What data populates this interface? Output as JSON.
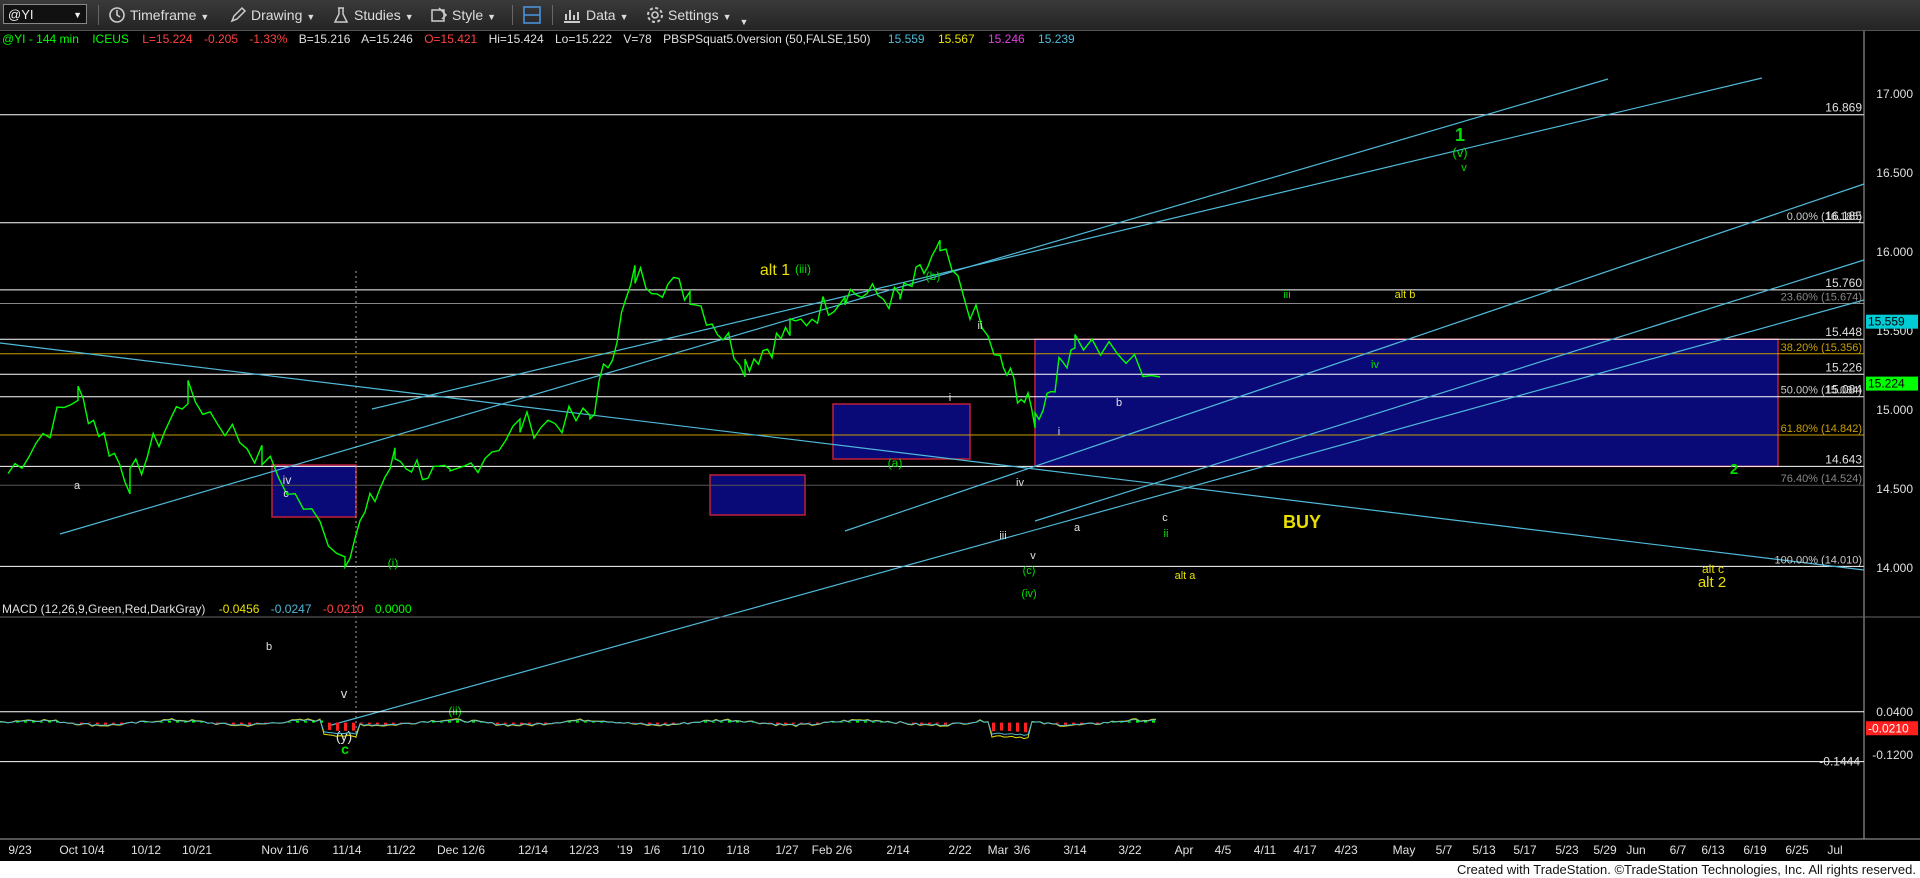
{
  "toolbar": {
    "symbol": "@YI",
    "timeframe": "Timeframe",
    "drawing": "Drawing",
    "studies": "Studies",
    "style": "Style",
    "data": "Data",
    "settings": "Settings"
  },
  "header": {
    "symbol_info": "@YI - 144 min",
    "exchange": "ICEUS",
    "last": "L=15.224",
    "change": "-0.205",
    "change_pct": "-1.33%",
    "bid": "B=15.216",
    "ask": "A=15.246",
    "open": "O=15.421",
    "high": "Hi=15.424",
    "low": "Lo=15.222",
    "volume": "V=78",
    "study": "PBSPSquat5.0version (50,FALSE,150)",
    "study_values": [
      "15.559",
      "15.567",
      "15.246",
      "15.239"
    ]
  },
  "macd": {
    "label": "MACD (12,26,9,Green,Red,DarkGray)",
    "values": [
      "-0.0456",
      "-0.0247",
      "-0.0210",
      "0.0000"
    ]
  },
  "footer": "Created with TradeStation. ©TradeStation Technologies, Inc. All rights reserved.",
  "colors": {
    "up": "#00ff00",
    "down": "#ff3030",
    "channel": "#4fb9d8",
    "zone": "#0a0a8c",
    "wave_green": "#00e000",
    "wave_yellow": "#e8e000",
    "wave_white": "#e0e0e0"
  },
  "chart_data": {
    "type": "line",
    "symbol": "@YI",
    "y_axis": {
      "ticks": [
        "17.000",
        "16.500",
        "16.000",
        "15.500",
        "15.000",
        "14.500",
        "14.000"
      ],
      "ylim": [
        13.85,
        17.4
      ]
    },
    "x_axis": {
      "ticks": [
        "9/23",
        "Oct 10/4",
        "10/12",
        "10/21",
        "Nov 11/6",
        "11/14",
        "11/22",
        "Dec 12/6",
        "12/14",
        "12/23",
        "'19",
        "1/6",
        "1/10",
        "1/18",
        "1/27",
        "Feb 2/6",
        "2/14",
        "2/22",
        "Mar",
        "3/6",
        "3/14",
        "3/22",
        "Apr",
        "4/5",
        "4/11",
        "4/17",
        "4/23",
        "May",
        "5/7",
        "5/13",
        "5/17",
        "5/23",
        "5/29",
        "Jun",
        "6/7",
        "6/13",
        "6/19",
        "6/25",
        "Jul"
      ]
    },
    "series": [
      {
        "x": [
          "9/23",
          "Oct 10/4",
          "10/12",
          "10/21",
          "Nov 11/6",
          "11/14",
          "11/22",
          "Dec 12/6",
          "12/14",
          "12/23",
          "'19",
          "1/10",
          "1/18",
          "1/27",
          "Feb 2/6",
          "2/14",
          "2/22",
          "Mar",
          "3/6",
          "3/14",
          "3/22"
        ],
        "values": [
          14.6,
          15.1,
          14.55,
          15.1,
          14.7,
          14.08,
          14.7,
          14.55,
          14.9,
          14.95,
          15.85,
          15.75,
          15.3,
          15.5,
          15.75,
          15.7,
          16.0,
          15.3,
          14.95,
          15.45,
          15.224
        ]
      }
    ],
    "price_labels": [
      "16.869",
      "16.185",
      "15.760",
      "15.674",
      "15.559",
      "15.448",
      "15.356",
      "15.226",
      "15.224",
      "15.084",
      "14.842",
      "14.643",
      "14.524",
      "14.010"
    ],
    "fib_labels": [
      "0.00% (16.185)",
      "23.60% (15.674)",
      "38.20% (15.356)",
      "50.00% (15.084)",
      "61.80% (14.842)",
      "76.40% (14.524)",
      "100.00% (14.010)"
    ],
    "buy_zone": {
      "label": "BUY",
      "top": 15.448,
      "bottom": 14.643
    },
    "annotations": [
      {
        "text": "1",
        "color": "green"
      },
      {
        "text": "(v)",
        "color": "green"
      },
      {
        "text": "v",
        "color": "green"
      },
      {
        "text": "alt 1",
        "color": "yellow"
      },
      {
        "text": "(iii)",
        "color": "green"
      },
      {
        "text": "(b)",
        "color": "green"
      },
      {
        "text": "ii",
        "color": "white"
      },
      {
        "text": "i",
        "color": "white"
      },
      {
        "text": "(a)",
        "color": "green"
      },
      {
        "text": "iii",
        "color": "green"
      },
      {
        "text": "alt b",
        "color": "yellow"
      },
      {
        "text": "iv",
        "color": "green"
      },
      {
        "text": "b",
        "color": "white"
      },
      {
        "text": "i",
        "color": "white"
      },
      {
        "text": "iv",
        "color": "white"
      },
      {
        "text": "iii",
        "color": "white"
      },
      {
        "text": "v",
        "color": "white"
      },
      {
        "text": "(c)",
        "color": "green"
      },
      {
        "text": "(iv)",
        "color": "green"
      },
      {
        "text": "a",
        "color": "white"
      },
      {
        "text": "c",
        "color": "white"
      },
      {
        "text": "ii",
        "color": "green"
      },
      {
        "text": "alt a",
        "color": "yellow"
      },
      {
        "text": "2",
        "color": "green"
      },
      {
        "text": "alt c",
        "color": "yellow"
      },
      {
        "text": "alt 2",
        "color": "yellow"
      },
      {
        "text": "a",
        "color": "white"
      },
      {
        "text": "iv",
        "color": "white"
      },
      {
        "text": "c",
        "color": "white"
      },
      {
        "text": "b",
        "color": "white"
      },
      {
        "text": "v",
        "color": "white"
      },
      {
        "text": "(y)",
        "color": "white"
      },
      {
        "text": "c",
        "color": "green"
      },
      {
        "text": "(i)",
        "color": "green"
      },
      {
        "text": "(ii)",
        "color": "green"
      }
    ],
    "macd_axis": [
      "0.0400",
      "-0.0210",
      "-0.1444",
      "-0.1200"
    ]
  }
}
